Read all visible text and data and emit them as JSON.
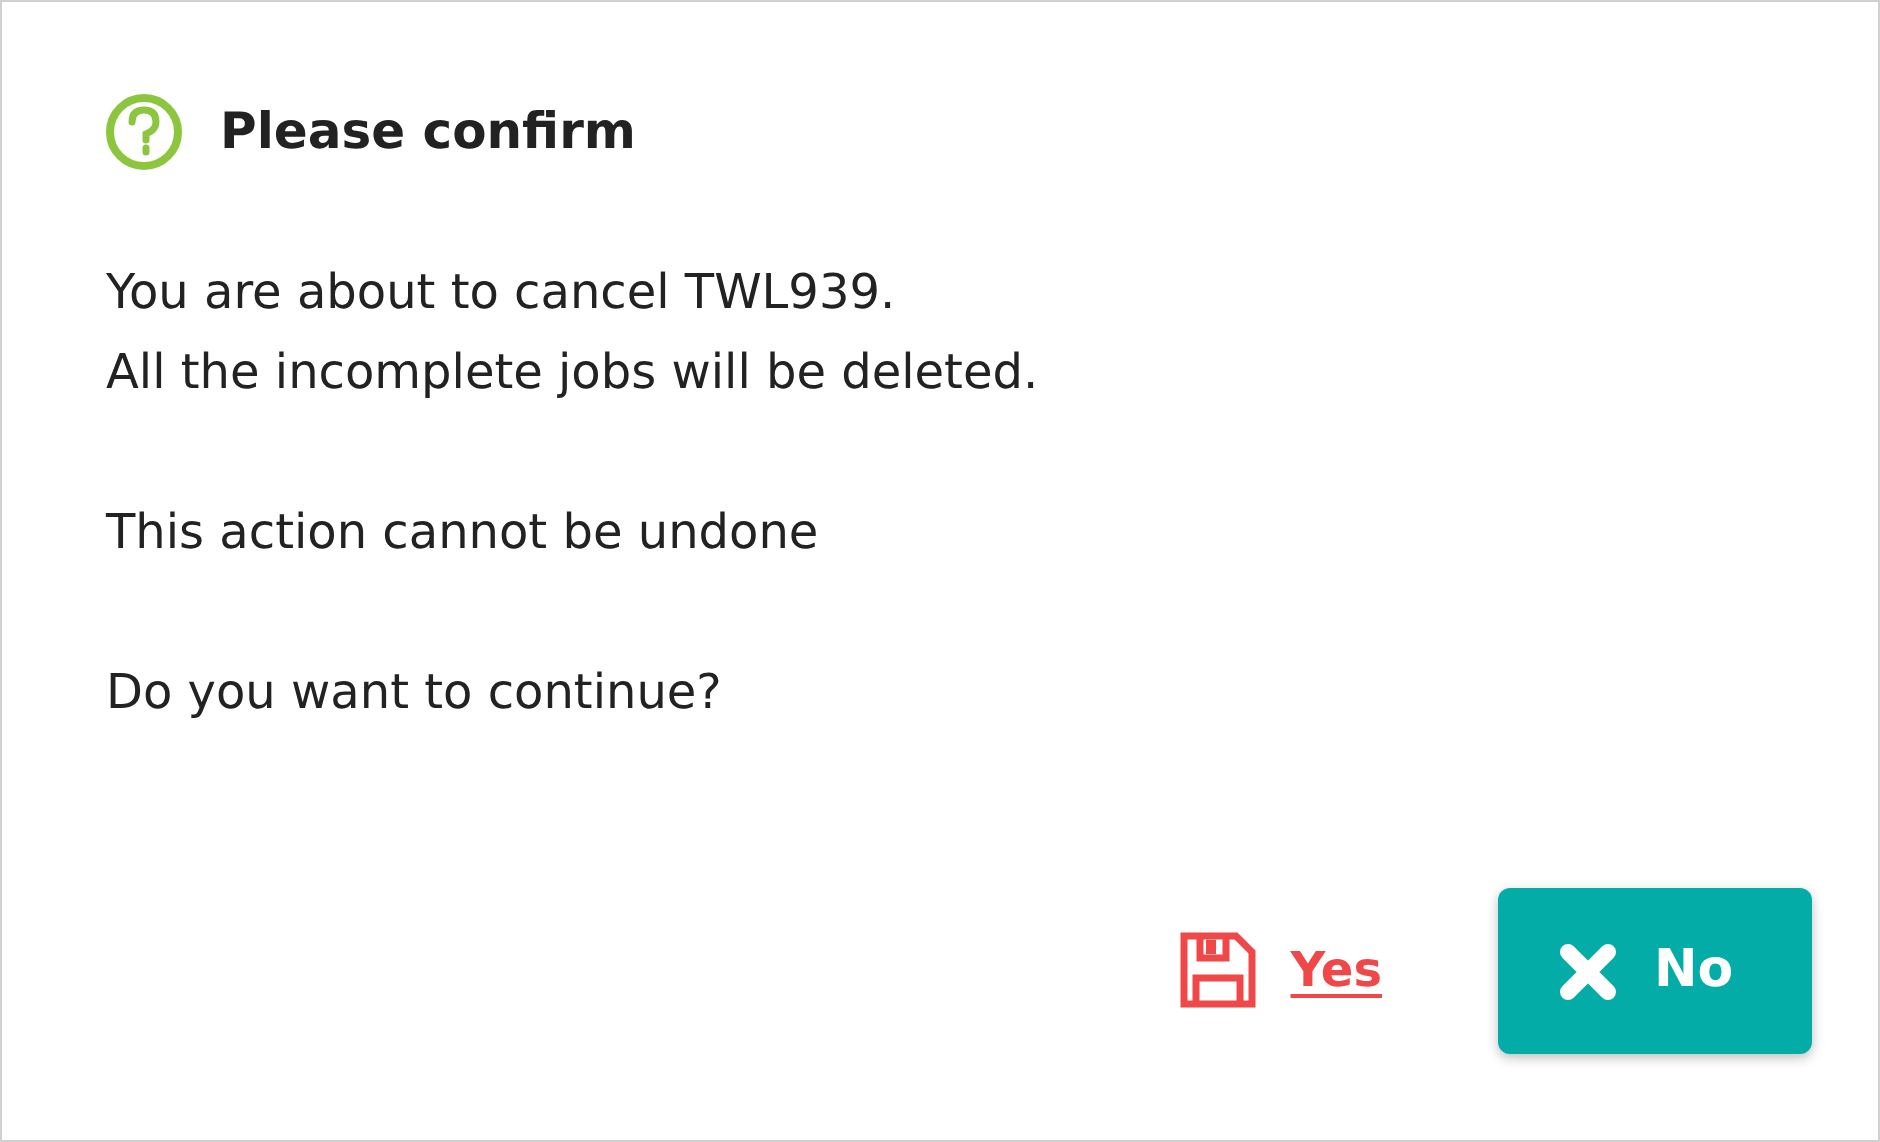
{
  "dialog": {
    "title": "Please confirm",
    "paragraphs": [
      [
        "You are about to cancel TWL939.",
        "All the incomplete jobs will be deleted."
      ],
      [
        "This action cannot be undone"
      ],
      [
        "Do you want to continue?"
      ]
    ],
    "buttons": [
      {
        "kind": "link",
        "label": "Yes"
      },
      {
        "kind": "primary",
        "label": "No"
      }
    ]
  }
}
